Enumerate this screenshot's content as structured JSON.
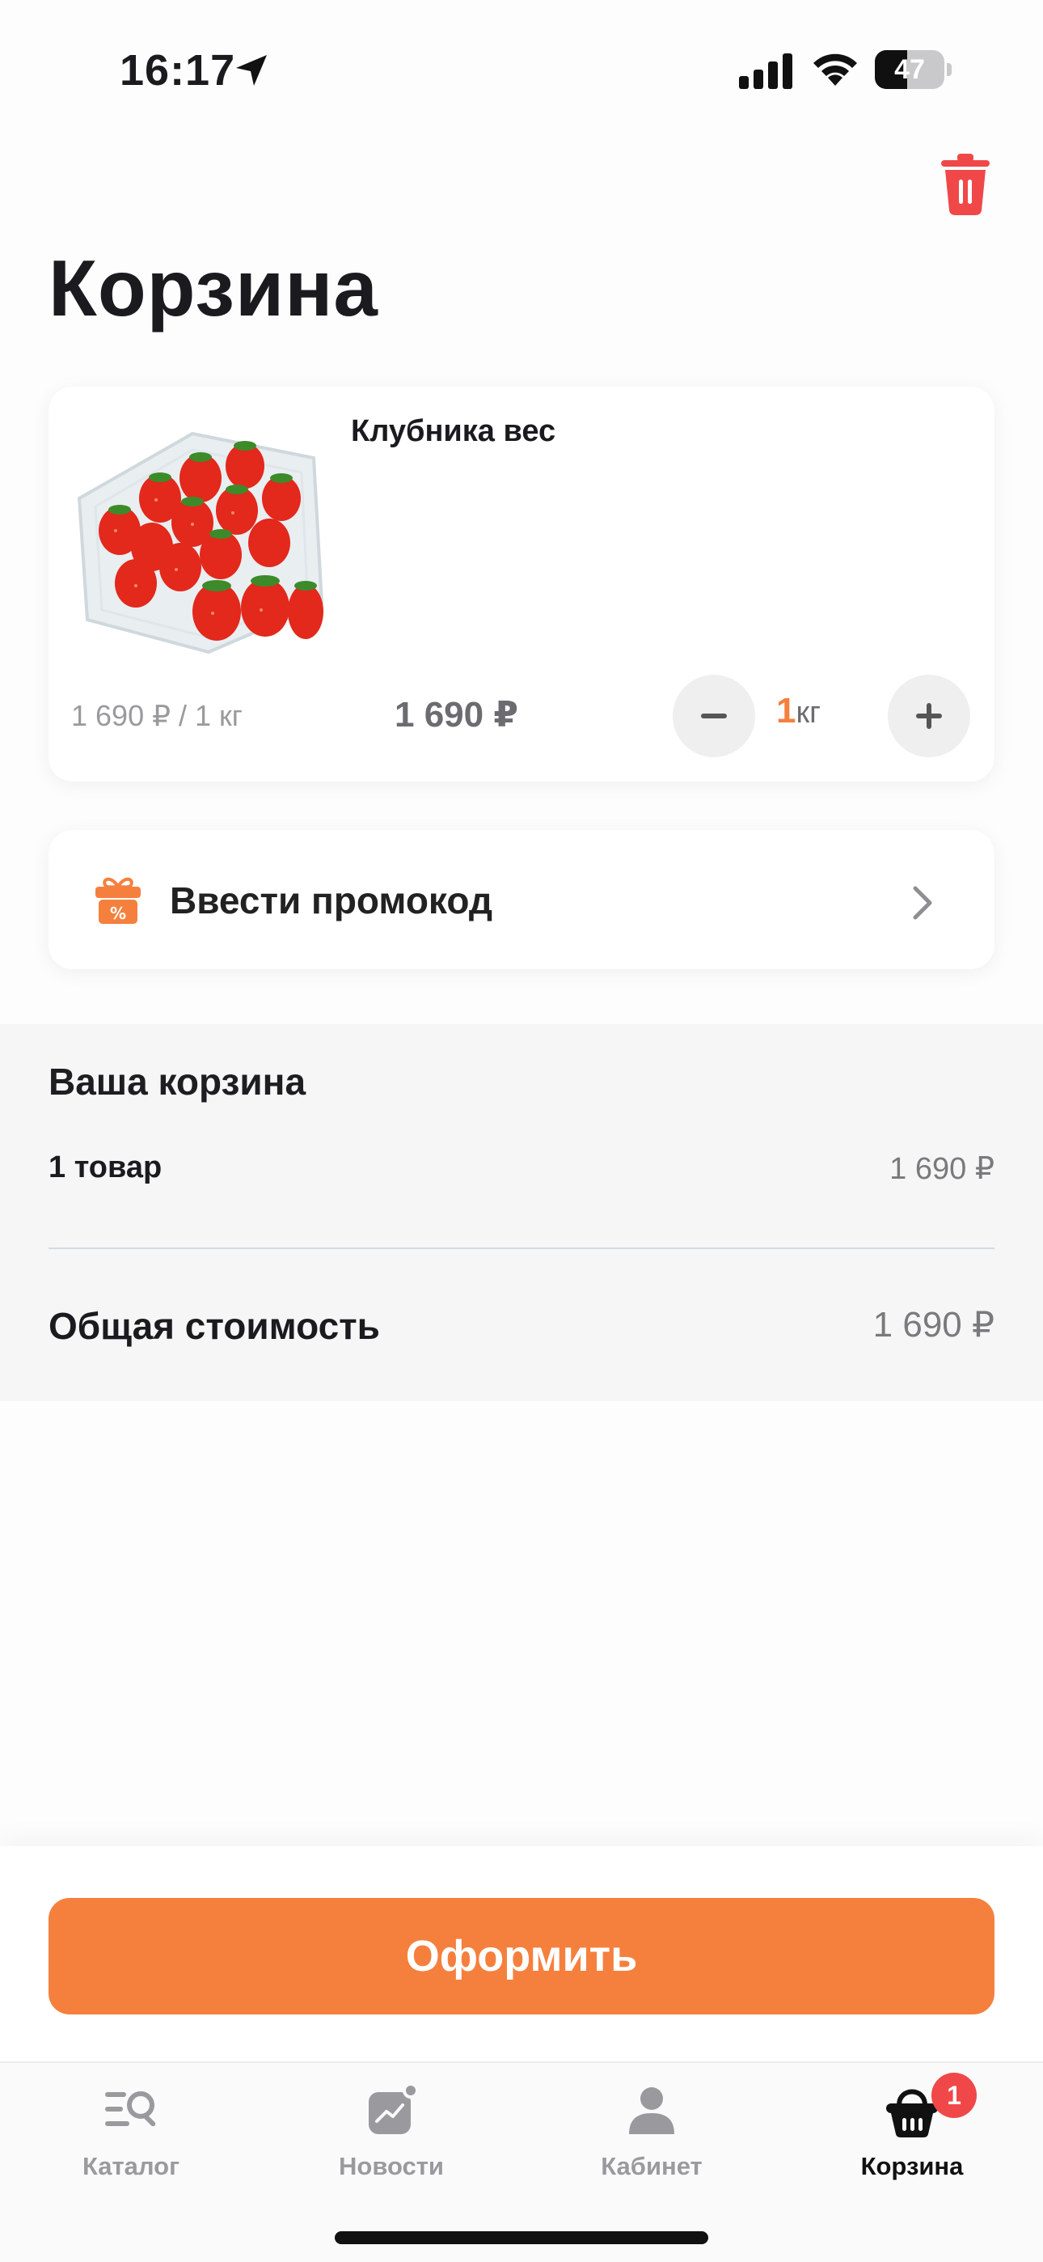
{
  "status_bar": {
    "time": "16:17",
    "battery_level": "47",
    "battery_fraction": 0.47
  },
  "page": {
    "title": "Корзина"
  },
  "cart_item": {
    "name": "Клубника вес",
    "unit_price": "1 690 ₽ / 1 кг",
    "total_price": "1 690 ₽",
    "quantity": "1",
    "quantity_unit": "кг",
    "image": "strawberry-punnet-image"
  },
  "promo": {
    "label": "Ввести промокод",
    "icon": "gift-percent-icon"
  },
  "summary": {
    "title": "Ваша корзина",
    "items_count_label": "1 товар",
    "items_price": "1 690 ₽",
    "total_label": "Общая стоимость",
    "total_price": "1 690 ₽"
  },
  "checkout": {
    "label": "Оформить"
  },
  "tabs": [
    {
      "label": "Каталог",
      "icon": "catalog-search-icon",
      "active": false
    },
    {
      "label": "Новости",
      "icon": "news-chart-icon",
      "active": false
    },
    {
      "label": "Кабинет",
      "icon": "profile-icon",
      "active": false
    },
    {
      "label": "Корзина",
      "icon": "basket-icon",
      "active": true,
      "badge": "1"
    }
  ],
  "colors": {
    "accent": "#f5803e",
    "danger": "#f04848",
    "summary_bg": "#f6f6f6"
  }
}
